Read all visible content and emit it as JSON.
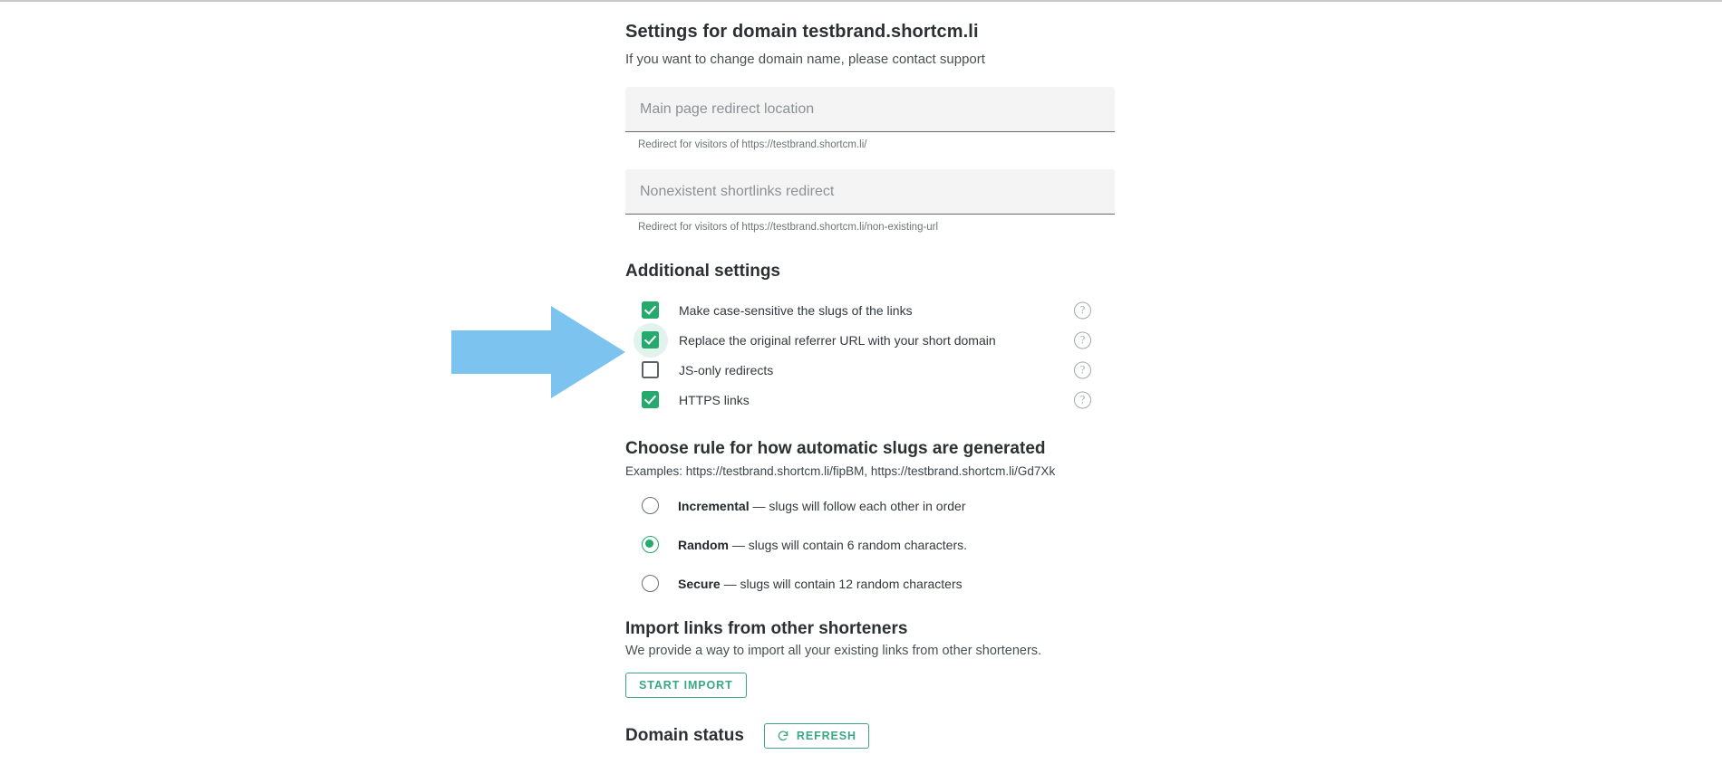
{
  "header": {
    "title": "Settings for domain testbrand.shortcm.li",
    "subtitle": "If you want to change domain name, please contact support"
  },
  "fields": [
    {
      "name": "main-page-redirect",
      "placeholder": "Main page redirect location",
      "value": "",
      "hint": "Redirect for visitors of https://testbrand.shortcm.li/"
    },
    {
      "name": "nonexistent-shortlinks-redirect",
      "placeholder": "Nonexistent shortlinks redirect",
      "value": "",
      "hint": "Redirect for visitors of https://testbrand.shortcm.li/non-existing-url"
    }
  ],
  "additional_settings": {
    "title": "Additional settings",
    "help_icon": "help-circle-icon",
    "options": [
      {
        "label": "Make case-sensitive the slugs of the links",
        "checked": true,
        "focused": false
      },
      {
        "label": "Replace the original referrer URL with your short domain",
        "checked": true,
        "focused": true
      },
      {
        "label": "JS-only redirects",
        "checked": false,
        "focused": false
      },
      {
        "label": "HTTPS links",
        "checked": true,
        "focused": false
      }
    ]
  },
  "slug_rules": {
    "title": "Choose rule for how automatic slugs are generated",
    "examples": "Examples: https://testbrand.shortcm.li/fipBM, https://testbrand.shortcm.li/Gd7Xk",
    "options": [
      {
        "name": "Incremental",
        "description": "— slugs will follow each other in order",
        "selected": false
      },
      {
        "name": "Random",
        "description": "— slugs will contain 6 random characters.",
        "selected": true
      },
      {
        "name": "Secure",
        "description": "— slugs will contain 12 random characters",
        "selected": false
      }
    ]
  },
  "import_section": {
    "title": "Import links from other shorteners",
    "description": "We provide a way to import all your existing links from other shorteners.",
    "button_label": "START IMPORT"
  },
  "domain_status": {
    "title": "Domain status",
    "refresh_label": "REFRESH",
    "refresh_icon": "refresh-icon"
  },
  "annotation": {
    "type": "arrow-right",
    "color": "#7dc3f0",
    "points_to": "Replace the original referrer URL with your short domain"
  },
  "colors": {
    "accent_green": "#25a96c",
    "button_green": "#3aa884",
    "arrow_blue": "#7dc3f0",
    "text_primary": "#2c3033"
  }
}
